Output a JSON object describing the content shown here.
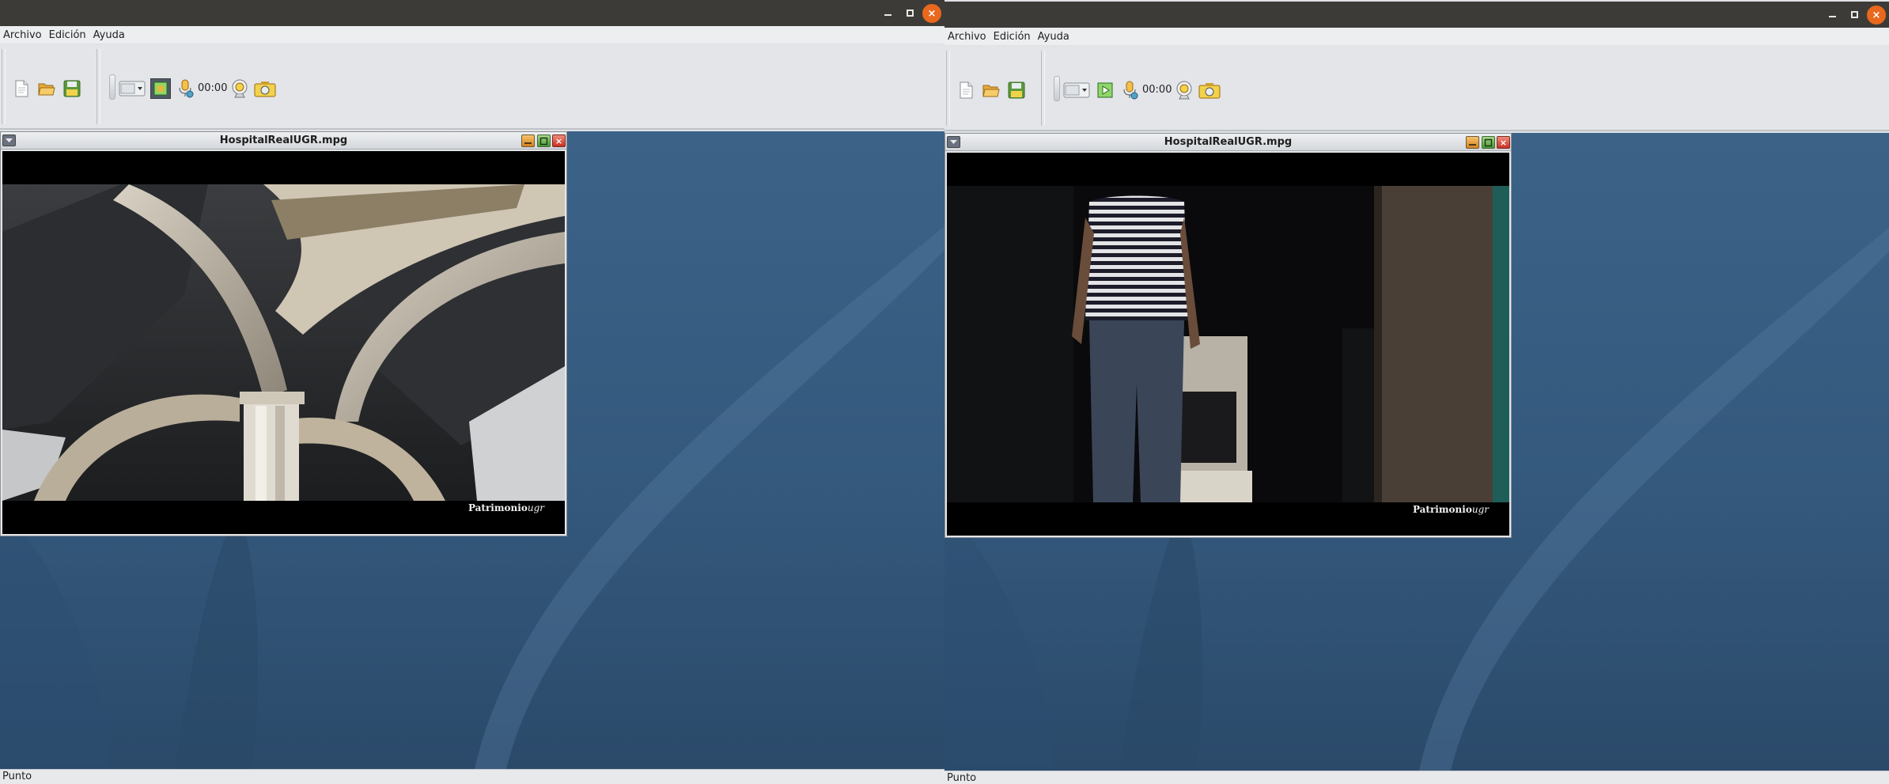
{
  "windows": [
    {
      "side": "left",
      "menu": [
        "Archivo",
        "Edición",
        "Ayuda"
      ],
      "time": "00:00",
      "play_icon": "stop-icon",
      "frame_title": "HospitalRealUGR.mpg",
      "watermark_main": "Patrimonio",
      "watermark_italic": "ugr",
      "status": "Punto"
    },
    {
      "side": "right",
      "menu": [
        "Archivo",
        "Edición",
        "Ayuda"
      ],
      "time": "00:00",
      "play_icon": "play-icon",
      "frame_title": "HospitalRealUGR.mpg",
      "watermark_main": "Patrimonio",
      "watermark_italic": "ugr",
      "status": "Punto"
    }
  ],
  "titlebar": {
    "close_glyph": "×"
  },
  "colors": {
    "desktop": "#3c6288",
    "titlebar": "#3d3b37",
    "close": "#e8681d"
  }
}
